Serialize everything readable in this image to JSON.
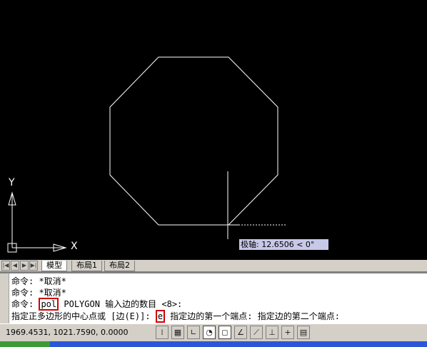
{
  "tooltip": {
    "label": "极轴:",
    "value": "12.6506 < 0°"
  },
  "ucs": {
    "y_label": "Y",
    "x_label": "X"
  },
  "tabs": [
    {
      "label": "模型",
      "active": true
    },
    {
      "label": "布局1",
      "active": false
    },
    {
      "label": "布局2",
      "active": false
    }
  ],
  "command_history": {
    "line1": "命令: *取消*",
    "line2": "命令: *取消*",
    "line3_prefix": "命令: ",
    "line3_highlight": "pol",
    "line3_suffix": " POLYGON 输入边的数目 <8>:",
    "line4_prefix": "指定正多边形的中心点或 [边(E)]: ",
    "line4_highlight": "e",
    "line4_suffix": " 指定边的第一个端点: 指定边的第二个端点:"
  },
  "status": {
    "coordinates": "1969.4531, 1021.7590, 0.0000"
  },
  "status_buttons": [
    {
      "name": "snap-icon",
      "glyph": "⁞",
      "on": false
    },
    {
      "name": "grid-icon",
      "glyph": "▦",
      "on": false
    },
    {
      "name": "ortho-icon",
      "glyph": "∟",
      "on": false
    },
    {
      "name": "polar-icon",
      "glyph": "◔",
      "on": true
    },
    {
      "name": "osnap-icon",
      "glyph": "◻",
      "on": true
    },
    {
      "name": "otrack-icon",
      "glyph": "∠",
      "on": false
    },
    {
      "name": "ducs-icon",
      "glyph": "⟋",
      "on": false
    },
    {
      "name": "dyn-icon",
      "glyph": "⊥",
      "on": false
    },
    {
      "name": "lwt-icon",
      "glyph": "+",
      "on": false
    },
    {
      "name": "qp-icon",
      "glyph": "▤",
      "on": false
    }
  ],
  "colors": {
    "canvas": "#000000",
    "highlight": "#d00000",
    "tooltip_bg": "#c8c8e8"
  }
}
